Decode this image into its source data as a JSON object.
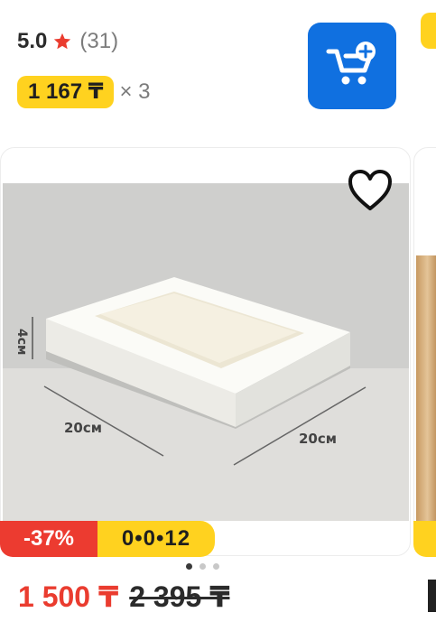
{
  "product": {
    "rating": "5.0",
    "reviews": "(31)",
    "monthly_payment": "1 167 ₸",
    "multiplier": "× 3",
    "discount": "-37%",
    "installment": "0•0•12",
    "current_price": "1 500 ₸",
    "old_price": "2 395 ₸",
    "dimension_labels": [
      "4см",
      "20см",
      "20см"
    ]
  },
  "colors": {
    "accent_yellow": "#ffd21f",
    "accent_red": "#ea3c2f",
    "cart_blue": "#1070e0"
  },
  "icons": {
    "star": "star-icon",
    "cart": "cart-add-icon",
    "heart": "heart-icon"
  },
  "carousel": {
    "pages": 3,
    "active": 1
  }
}
